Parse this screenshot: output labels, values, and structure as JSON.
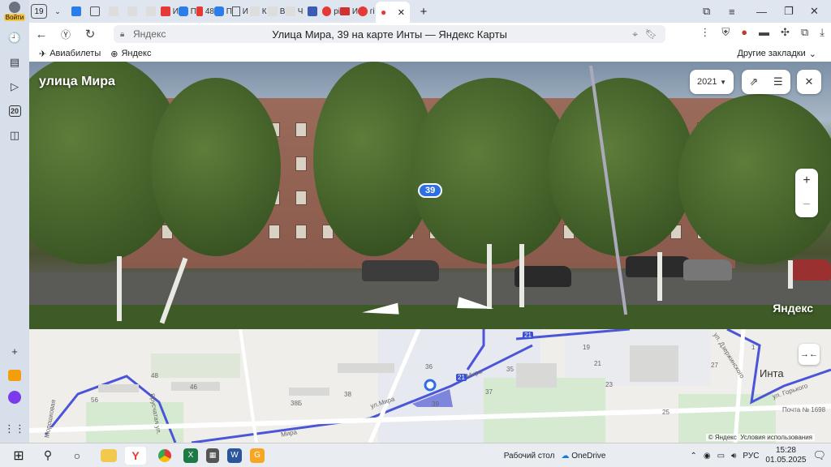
{
  "sidebar": {
    "login_label": "Войти",
    "badge_number": "20"
  },
  "tabs": {
    "count": "19",
    "pinned": [
      "И",
      "П",
      "48",
      "П",
      "И",
      "К",
      "В",
      "Ч",
      "рі",
      "И",
      "гі"
    ],
    "active_favicon": "map-pin"
  },
  "addressbar": {
    "site": "Яндекс",
    "title": "Улица Мира, 39 на карте Инты — Яндекс Карты"
  },
  "bookmarks": {
    "items": [
      "Авиабилеты",
      "Яндекс"
    ],
    "other": "Другие закладки"
  },
  "panorama": {
    "street_name": "улица Мира",
    "house_number": "39",
    "year": "2021",
    "zoom_in": "+",
    "zoom_out": "−",
    "brand": "Яндекс"
  },
  "map": {
    "city": "Инта",
    "street_labels": [
      "улМира",
      "ул.Мира",
      "ул. Горького",
      "ул. Дзержинского",
      "Мира"
    ],
    "house_numbers": [
      "48",
      "46",
      "56",
      "38Б",
      "38",
      "36",
      "35",
      "37",
      "39",
      "19",
      "21",
      "23",
      "25",
      "27",
      "1"
    ],
    "route_badges": [
      "21",
      "21"
    ],
    "side_street": "Брусчатая ул.",
    "left_street": "Морошковая",
    "poi": "Почта № 1698",
    "footer_copyright": "© Яндекс",
    "footer_terms": "Условия использования"
  },
  "taskbar": {
    "desktop_label": "Рабочий стол",
    "onedrive": "OneDrive",
    "lang": "РУС",
    "time": "15:28",
    "date": "01.05.2025"
  }
}
